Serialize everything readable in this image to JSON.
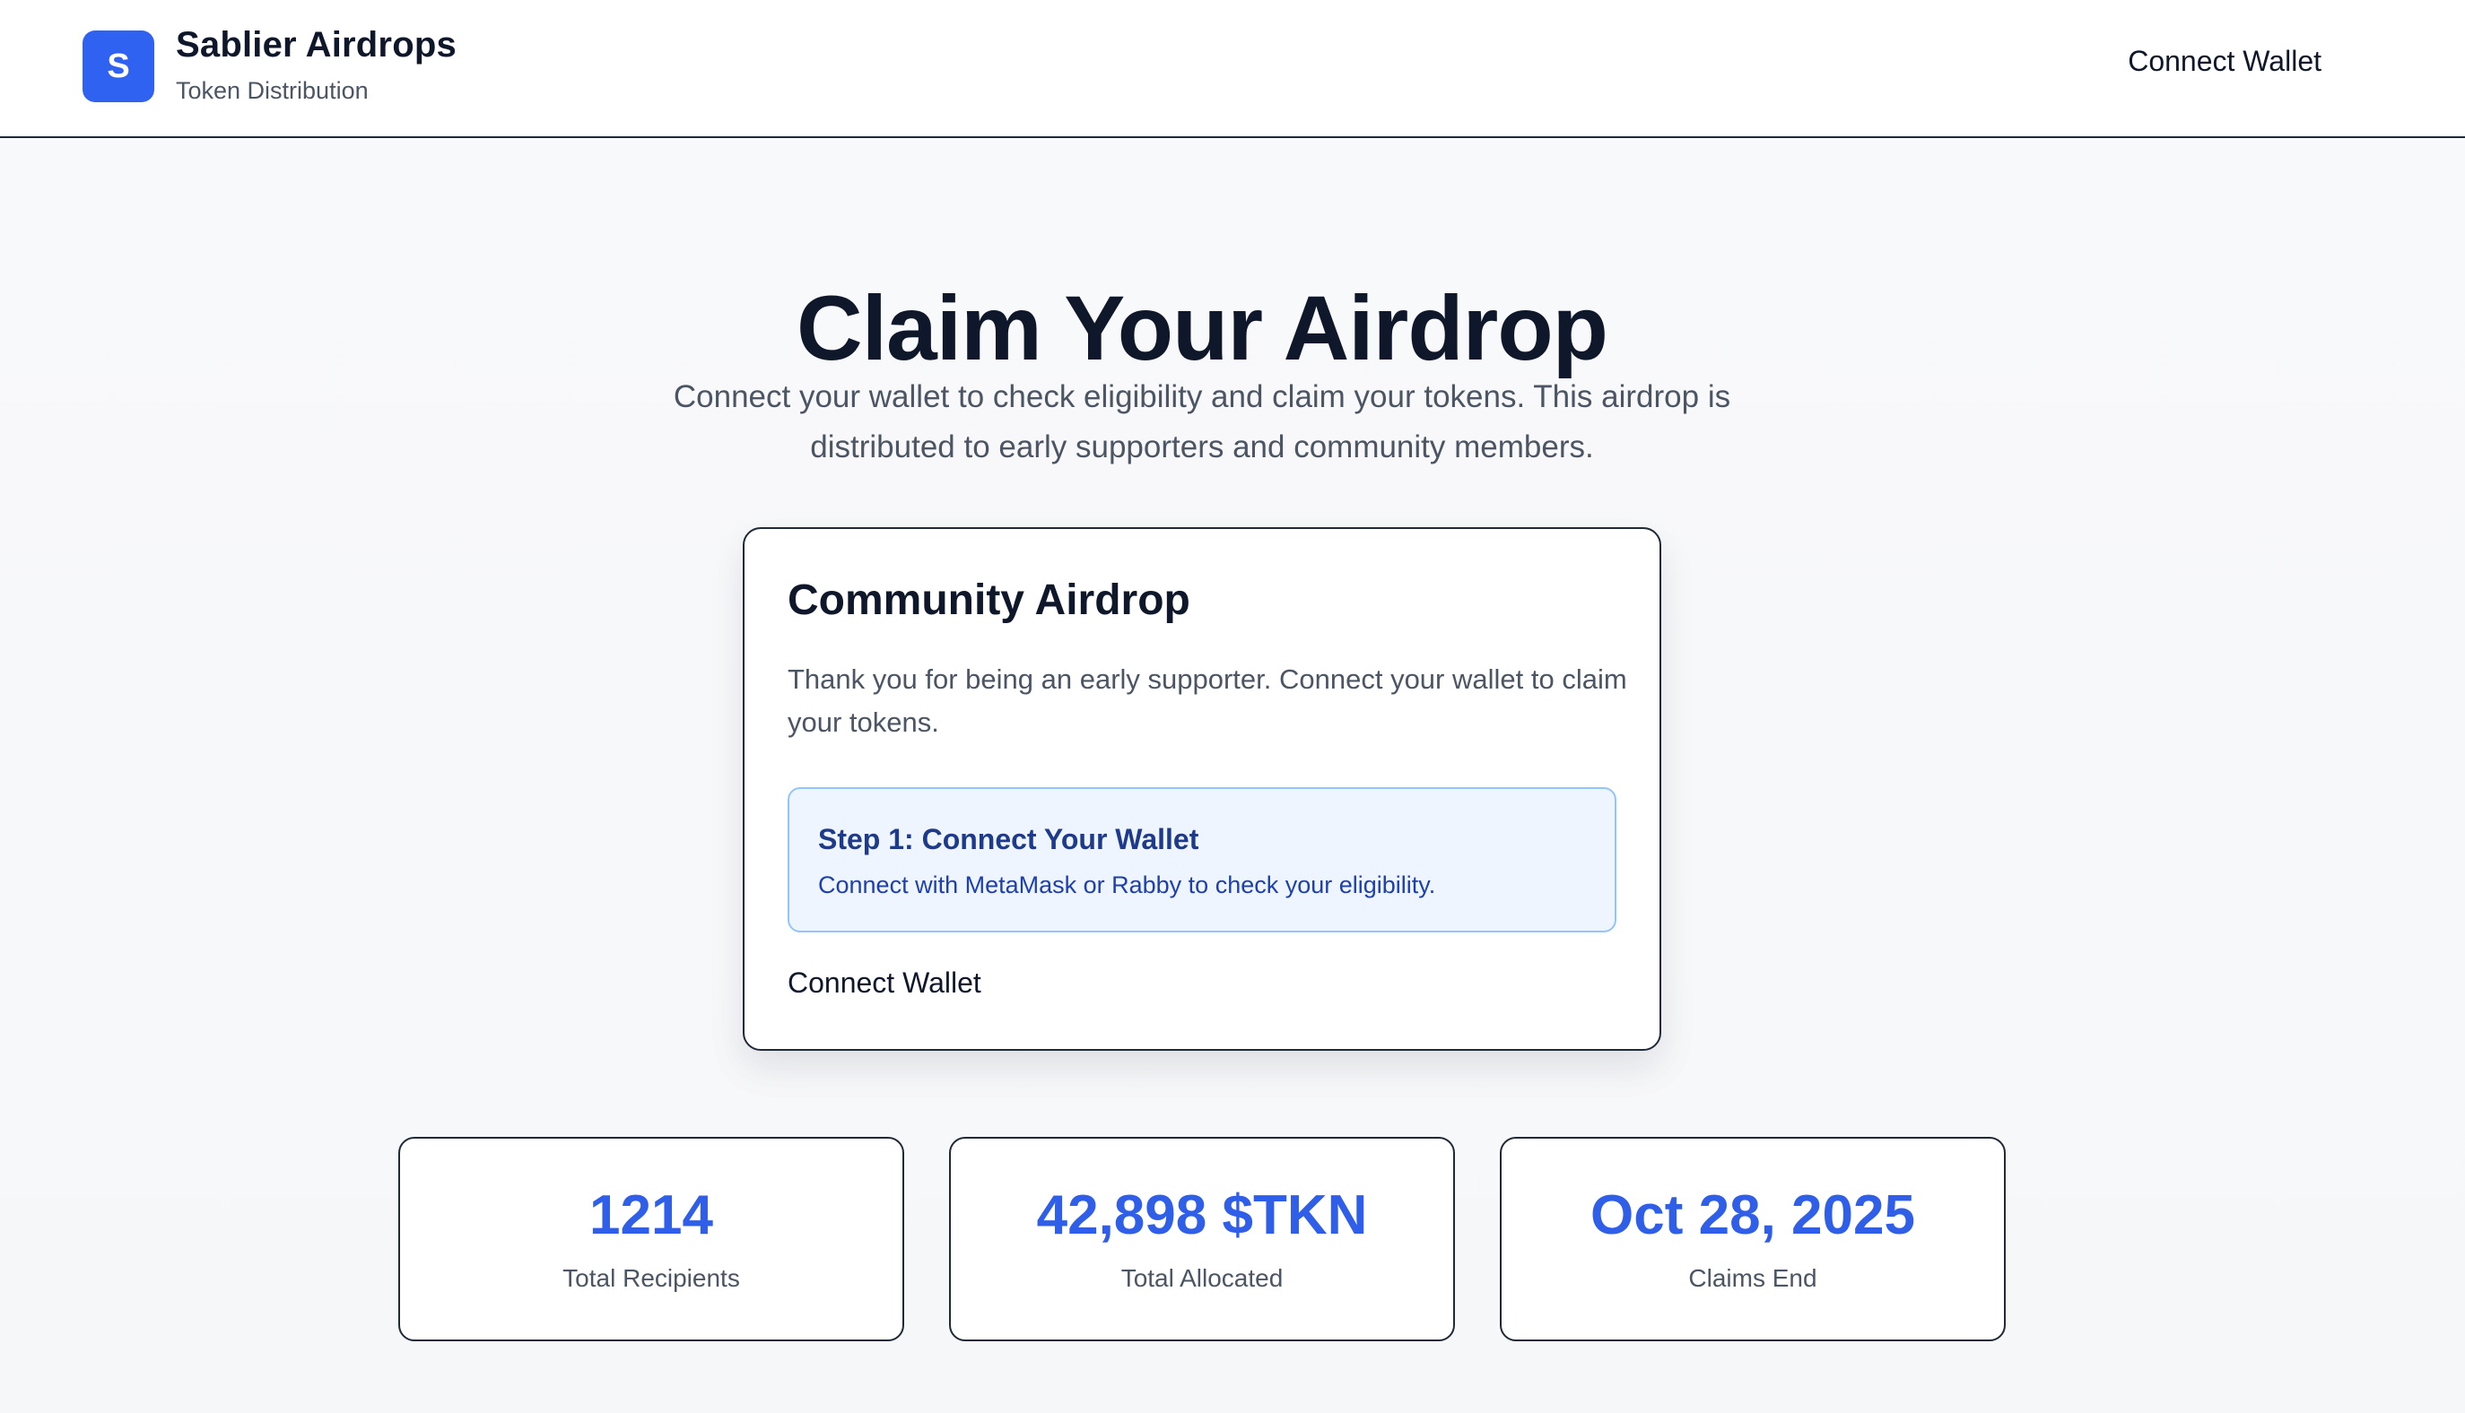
{
  "header": {
    "logo_letter": "S",
    "title": "Sablier Airdrops",
    "subtitle": "Token Distribution",
    "connect_label": "Connect Wallet"
  },
  "hero": {
    "title": "Claim Your Airdrop",
    "description": "Connect your wallet to check eligibility and claim your tokens. This airdrop is distributed to early supporters and community members."
  },
  "card": {
    "title": "Community Airdrop",
    "description": "Thank you for being an early supporter. Connect your wallet to claim your tokens.",
    "step": {
      "title": "Step 1: Connect Your Wallet",
      "description": "Connect with MetaMask or Rabby to check your eligibility."
    },
    "connect_label": "Connect Wallet"
  },
  "stats": [
    {
      "value": "1214",
      "label": "Total Recipients"
    },
    {
      "value": "42,898 $TKN",
      "label": "Total Allocated"
    },
    {
      "value": "Oct 28, 2025",
      "label": "Claims End"
    }
  ],
  "colors": {
    "accent": "#2f62f0",
    "step_bg": "#eef5ff",
    "step_border": "#93c5fd",
    "stat_value": "#2f5ee8"
  }
}
